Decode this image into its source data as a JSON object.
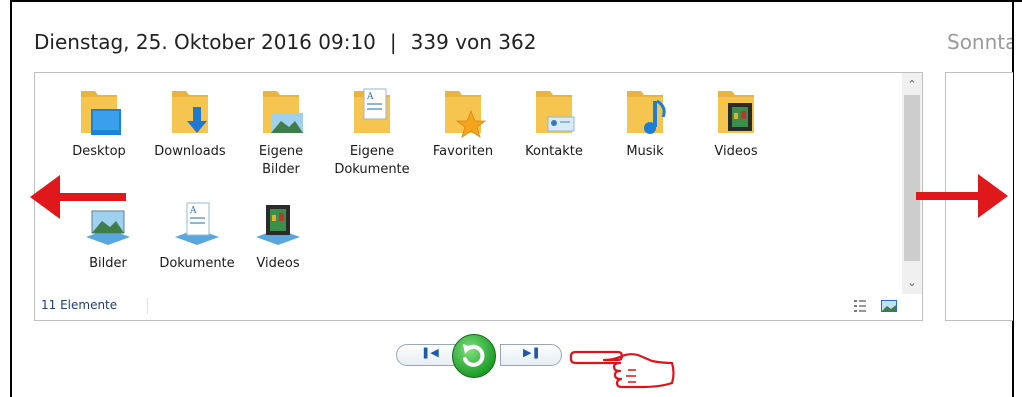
{
  "header": {
    "date_time": "Dienstag, 25. Oktober 2016 09:10",
    "separator": "|",
    "counter": "339 von 362",
    "next_header_fragment": "Sonnta"
  },
  "explorer": {
    "items": [
      {
        "label": "Desktop",
        "icon": "desktop-folder-icon"
      },
      {
        "label": "Downloads",
        "icon": "downloads-folder-icon"
      },
      {
        "label": "Eigene Bilder",
        "icon": "pictures-folder-icon"
      },
      {
        "label": "Eigene Dokumente",
        "icon": "documents-folder-icon"
      },
      {
        "label": "Favoriten",
        "icon": "favorites-folder-icon"
      },
      {
        "label": "Kontakte",
        "icon": "contacts-folder-icon"
      },
      {
        "label": "Musik",
        "icon": "music-folder-icon"
      },
      {
        "label": "Videos",
        "icon": "videos-folder-icon"
      },
      {
        "label": "Bilder",
        "icon": "pictures-library-icon"
      },
      {
        "label": "Dokumente",
        "icon": "documents-library-icon"
      },
      {
        "label": "Videos",
        "icon": "videos-library-icon"
      }
    ],
    "status_text": "11 Elemente"
  },
  "colors": {
    "arrow_red": "#e0181b",
    "folder_yellow": "#f6c550",
    "refresh_green": "#1f9e2a",
    "hand_red": "#d9161c"
  }
}
